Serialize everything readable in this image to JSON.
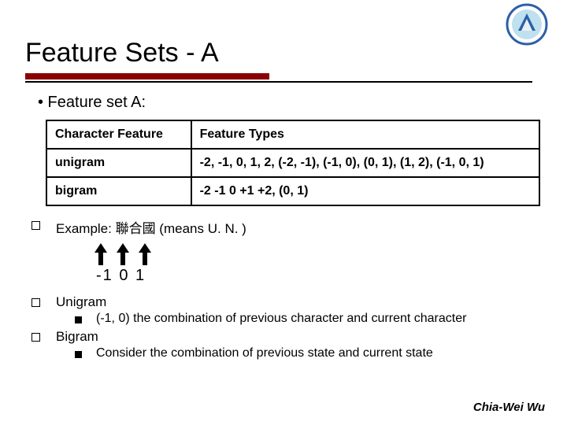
{
  "title": "Feature Sets - A",
  "lead": "• Feature set A:",
  "table": {
    "h1": "Character Feature",
    "h2": "Feature Types",
    "r1c1": "unigram",
    "r1c2": "-2, -1, 0, 1, 2, (-2, -1), (-1, 0), (0, 1), (1, 2), (-1, 0, 1)",
    "r2c1": "bigram",
    "r2c2": "-2 -1 0 +1 +2, (0, 1)"
  },
  "example": "Example: 聯合國 (means U. N. )",
  "indices": "-1  0 1",
  "unigram_label": "Unigram",
  "unigram_desc": "(-1, 0) the combination of previous character and current character",
  "bigram_label": "Bigram",
  "bigram_desc": "Consider the combination of previous state and current state",
  "footer": "Chia-Wei Wu"
}
